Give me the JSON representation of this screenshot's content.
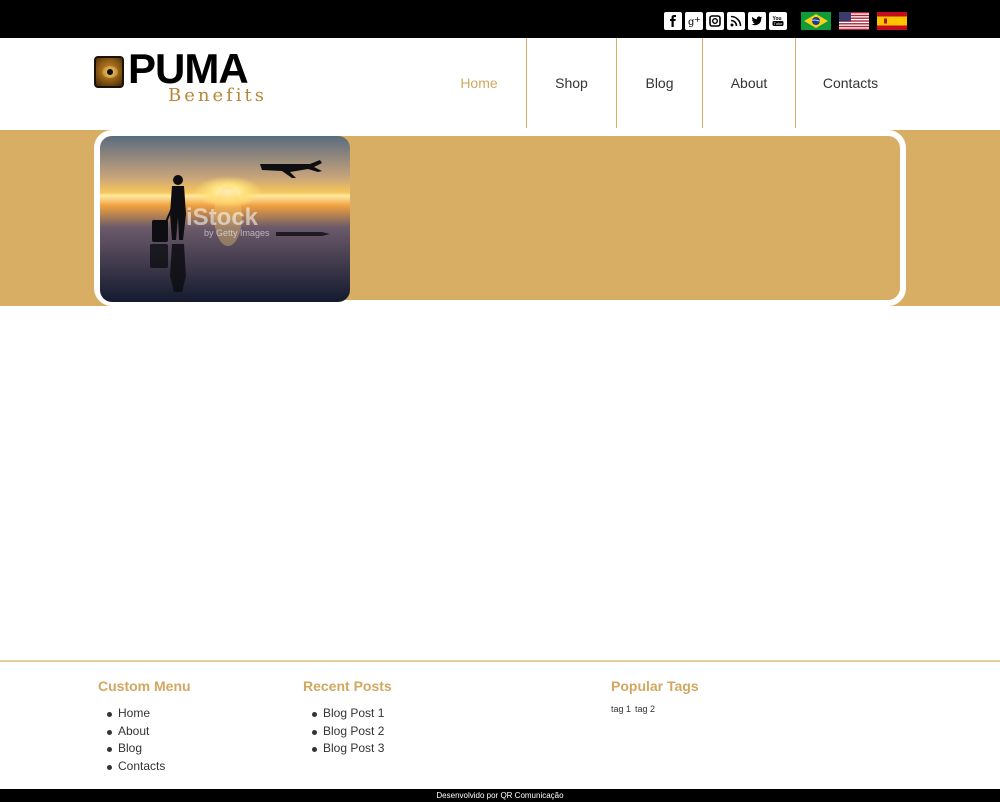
{
  "social": {
    "icons": [
      "facebook-icon",
      "google-plus-icon",
      "instagram-icon",
      "rss-icon",
      "twitter-icon",
      "youtube-icon"
    ]
  },
  "flags": [
    "brazil-flag-icon",
    "usa-flag-icon",
    "spain-flag-icon"
  ],
  "logo": {
    "name": "PUMA",
    "sub": "Benefits"
  },
  "nav": {
    "items": [
      {
        "label": "Home"
      },
      {
        "label": "Shop"
      },
      {
        "label": "Blog"
      },
      {
        "label": "About"
      },
      {
        "label": "Contacts"
      }
    ]
  },
  "banner": {
    "watermark": "iStock",
    "watermark_sub": "by Getty Images"
  },
  "footer": {
    "custom_menu": {
      "title": "Custom Menu",
      "items": [
        "Home",
        "About",
        "Blog",
        "Contacts"
      ]
    },
    "recent_posts": {
      "title": "Recent Posts",
      "items": [
        "Blog Post 1",
        "Blog Post 2",
        "Blog Post 3"
      ]
    },
    "popular_tags": {
      "title": "Popular Tags",
      "tags": [
        "tag 1",
        "tag 2"
      ]
    },
    "credit": "Desenvolvido por QR Comunicação"
  },
  "colors": {
    "accent": "#d8ae64",
    "heading": "#d2a860",
    "bar": "#000000"
  }
}
